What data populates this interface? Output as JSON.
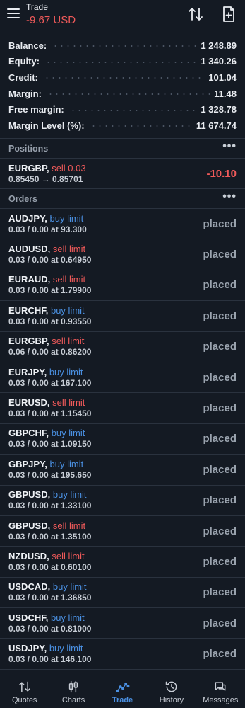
{
  "header": {
    "title": "Trade",
    "subtitle": "-9.67 USD"
  },
  "account": [
    {
      "label": "Balance:",
      "value": "1 248.89"
    },
    {
      "label": "Equity:",
      "value": "1 340.26"
    },
    {
      "label": "Credit:",
      "value": "101.04"
    },
    {
      "label": "Margin:",
      "value": "11.48"
    },
    {
      "label": "Free margin:",
      "value": "1 328.78"
    },
    {
      "label": "Margin Level (%):",
      "value": "11 674.74"
    }
  ],
  "positions": {
    "title": "Positions",
    "items": [
      {
        "symbol": "EURGBP,",
        "side": "sell 0.03",
        "detail": "0.85450 → 0.85701",
        "profit": "-10.10"
      }
    ]
  },
  "orders": {
    "title": "Orders",
    "items": [
      {
        "symbol": "AUDJPY,",
        "type": "buy limit",
        "detail": "0.03 / 0.00 at 93.300",
        "status": "placed"
      },
      {
        "symbol": "AUDUSD,",
        "type": "sell limit",
        "detail": "0.03 / 0.00 at 0.64950",
        "status": "placed"
      },
      {
        "symbol": "EURAUD,",
        "type": "sell limit",
        "detail": "0.03 / 0.00 at 1.79900",
        "status": "placed"
      },
      {
        "symbol": "EURCHF,",
        "type": "buy limit",
        "detail": "0.03 / 0.00 at 0.93550",
        "status": "placed"
      },
      {
        "symbol": "EURGBP,",
        "type": "sell limit",
        "detail": "0.06 / 0.00 at 0.86200",
        "status": "placed"
      },
      {
        "symbol": "EURJPY,",
        "type": "buy limit",
        "detail": "0.03 / 0.00 at 167.100",
        "status": "placed"
      },
      {
        "symbol": "EURUSD,",
        "type": "sell limit",
        "detail": "0.03 / 0.00 at 1.15450",
        "status": "placed"
      },
      {
        "symbol": "GBPCHF,",
        "type": "buy limit",
        "detail": "0.03 / 0.00 at 1.09150",
        "status": "placed"
      },
      {
        "symbol": "GBPJPY,",
        "type": "buy limit",
        "detail": "0.03 / 0.00 at 195.650",
        "status": "placed"
      },
      {
        "symbol": "GBPUSD,",
        "type": "buy limit",
        "detail": "0.03 / 0.00 at 1.33100",
        "status": "placed"
      },
      {
        "symbol": "GBPUSD,",
        "type": "sell limit",
        "detail": "0.03 / 0.00 at 1.35100",
        "status": "placed"
      },
      {
        "symbol": "NZDUSD,",
        "type": "sell limit",
        "detail": "0.03 / 0.00 at 0.60100",
        "status": "placed"
      },
      {
        "symbol": "USDCAD,",
        "type": "buy limit",
        "detail": "0.03 / 0.00 at 1.36850",
        "status": "placed"
      },
      {
        "symbol": "USDCHF,",
        "type": "buy limit",
        "detail": "0.03 / 0.00 at 0.81000",
        "status": "placed"
      },
      {
        "symbol": "USDJPY,",
        "type": "buy limit",
        "detail": "0.03 / 0.00 at 146.100",
        "status": "placed"
      }
    ]
  },
  "nav": [
    {
      "label": "Quotes",
      "icon": "quotes-icon"
    },
    {
      "label": "Charts",
      "icon": "charts-icon"
    },
    {
      "label": "Trade",
      "icon": "trade-icon",
      "active": true
    },
    {
      "label": "History",
      "icon": "history-icon"
    },
    {
      "label": "Messages",
      "icon": "messages-icon"
    }
  ],
  "colors": {
    "background": "#141a23",
    "sell": "#f05a5a",
    "buy": "#4a90e2",
    "active": "#4a90e2"
  }
}
